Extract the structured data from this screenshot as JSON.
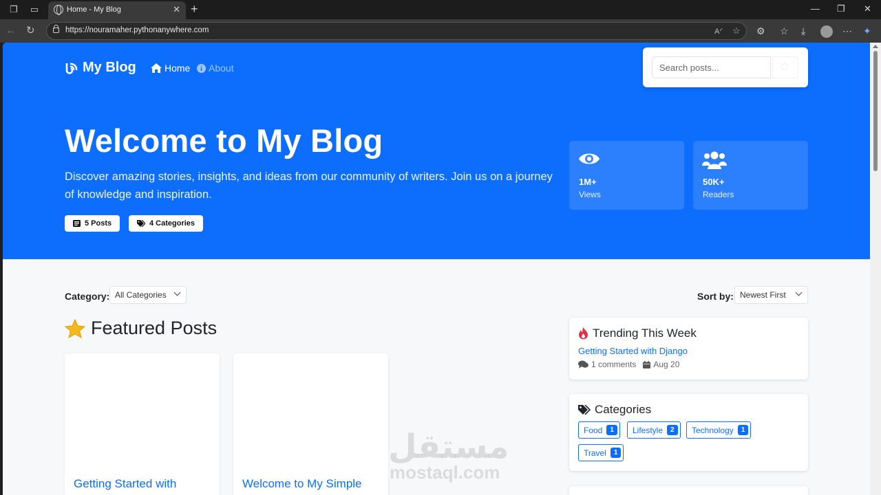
{
  "browser": {
    "tab_title": "Home - My Blog",
    "tab_close": "✕",
    "new_tab": "+",
    "url": "https://nouramaher.pythonanywhere.com",
    "window_min": "—",
    "window_max": "❐",
    "window_close": "✕"
  },
  "header": {
    "brand": "My Blog",
    "nav": {
      "home": "Home",
      "about": "About"
    },
    "search_placeholder": "Search posts..."
  },
  "hero": {
    "title": "Welcome to My Blog",
    "description": "Discover amazing stories, insights, and ideas from our community of writers. Join us on a journey of knowledge and inspiration.",
    "posts_pill": "5 Posts",
    "categories_pill": "4 Categories",
    "stats": [
      {
        "value": "1M+",
        "label": "Views",
        "icon": "eye-icon"
      },
      {
        "value": "50K+",
        "label": "Readers",
        "icon": "users-icon"
      }
    ]
  },
  "filters": {
    "category_label": "Category:",
    "category_value": "All Categories",
    "sort_label": "Sort by:",
    "sort_value": "Newest First"
  },
  "featured": {
    "heading": "Featured Posts",
    "posts": [
      {
        "title": "Getting Started with"
      },
      {
        "title": "Welcome to My Simple"
      }
    ]
  },
  "sidebar": {
    "trending": {
      "title": "Trending This Week",
      "post_title": "Getting Started with Django",
      "comments": "1 comments",
      "date": "Aug 20"
    },
    "categories": {
      "title": "Categories",
      "items": [
        {
          "name": "Food",
          "count": "1"
        },
        {
          "name": "Lifestyle",
          "count": "2"
        },
        {
          "name": "Technology",
          "count": "1"
        },
        {
          "name": "Travel",
          "count": "1"
        }
      ]
    }
  },
  "watermark": {
    "arabic": "مستقل",
    "latin": "mostaql.com"
  },
  "colors": {
    "primary": "#0d6efd",
    "page_bg": "#f7f8fa",
    "chrome_dark": "#3a3a3a"
  }
}
